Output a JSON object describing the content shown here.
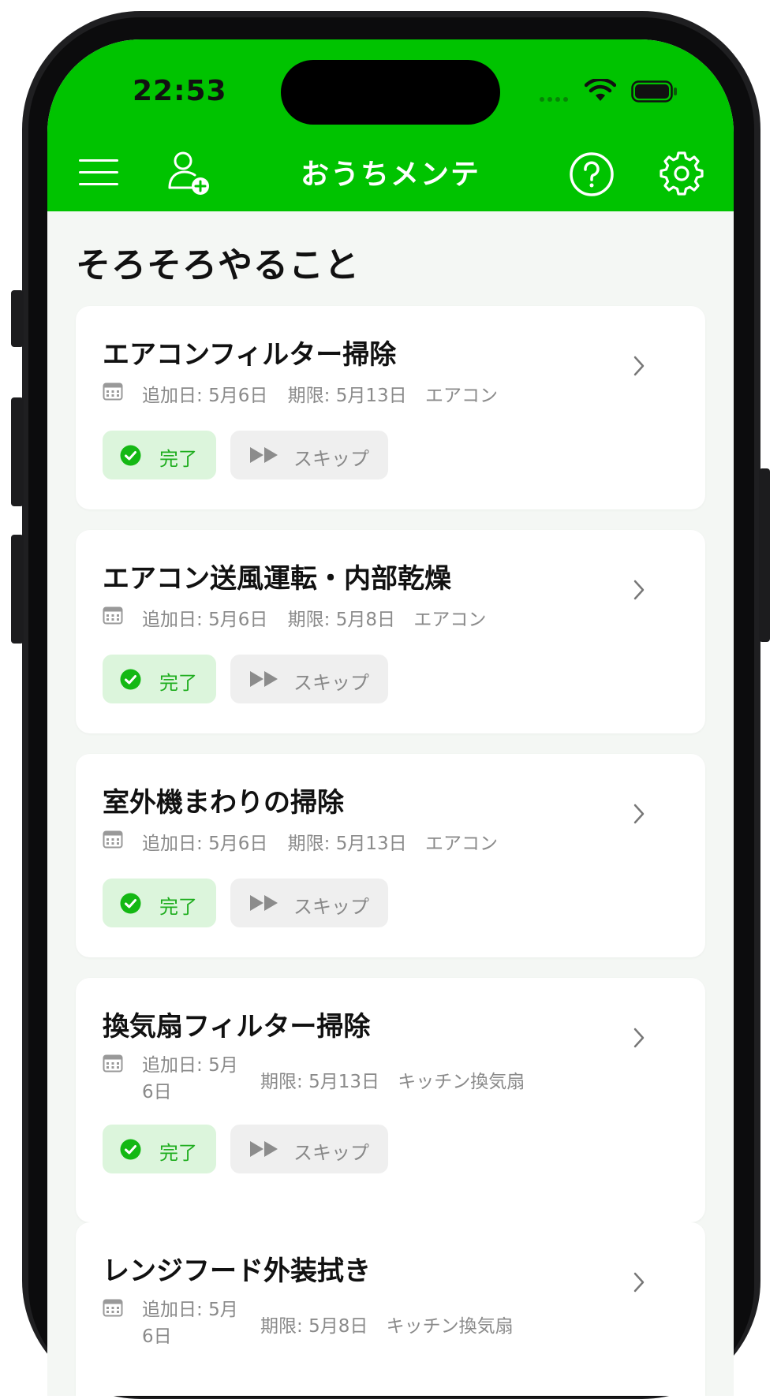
{
  "status_bar": {
    "time": "22:53"
  },
  "header": {
    "title": "おうちメンテ"
  },
  "section": {
    "title": "そろそろやること"
  },
  "tasks": [
    {
      "title": "エアコンフィルター掃除",
      "added_label": "追加日:",
      "added": "5月6日",
      "due_label": "期限:",
      "due": "5月13日",
      "category": "エアコン",
      "done_label": "完了",
      "skip_label": "スキップ"
    },
    {
      "title": "エアコン送風運転・内部乾燥",
      "added_label": "追加日:",
      "added": "5月6日",
      "due_label": "期限:",
      "due": "5月8日",
      "category": "エアコン",
      "done_label": "完了",
      "skip_label": "スキップ"
    },
    {
      "title": "室外機まわりの掃除",
      "added_label": "追加日:",
      "added": "5月6日",
      "due_label": "期限:",
      "due": "5月13日",
      "category": "エアコン",
      "done_label": "完了",
      "skip_label": "スキップ"
    },
    {
      "title": "換気扇フィルター掃除",
      "added_label": "追加日:",
      "added_line1": "5月",
      "added_line2": "6日",
      "due_label": "期限:",
      "due": "5月13日",
      "category": "キッチン換気扇",
      "done_label": "完了",
      "skip_label": "スキップ"
    },
    {
      "title": "レンジフード外装拭き",
      "added_label": "追加日:",
      "added_line1": "5月",
      "added_line2": "6日",
      "due_label": "期限:",
      "due": "5月8日",
      "category": "キッチン換気扇"
    }
  ],
  "colors": {
    "brand_green": "#00c300",
    "done_bg": "#dcf5dc",
    "done_text": "#1dad1d",
    "skip_bg": "#efefef"
  },
  "icons": [
    "menu-icon",
    "add-user-icon",
    "help-icon",
    "gear-icon",
    "calendar-icon",
    "check-circle-icon",
    "fast-forward-icon",
    "chevron-right-icon",
    "wifi-icon",
    "battery-icon"
  ]
}
